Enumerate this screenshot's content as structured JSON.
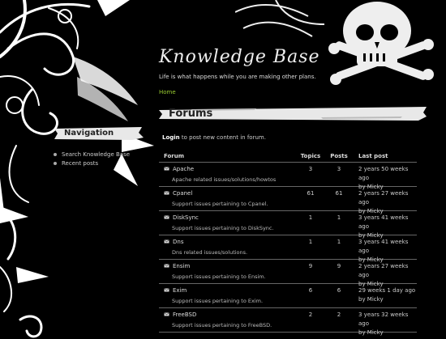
{
  "site": {
    "title": "Knowledge Base",
    "slogan": "Life is what happens while you are making other plans.",
    "breadcrumb": "Home"
  },
  "sidebar": {
    "heading": "Navigation",
    "items": [
      {
        "label": "Search Knowledge Base"
      },
      {
        "label": "Recent posts"
      }
    ]
  },
  "main": {
    "heading": "Forums",
    "login_link": "Login",
    "login_text": " to post new content in forum."
  },
  "table": {
    "headers": {
      "forum": "Forum",
      "topics": "Topics",
      "posts": "Posts",
      "last_post": "Last post"
    },
    "rows": [
      {
        "name": "Apache",
        "desc": "Apache related issues/solutions/howtos",
        "topics": "3",
        "posts": "3",
        "last_time": "2 years 50 weeks ago",
        "last_by": "by Micky"
      },
      {
        "name": "Cpanel",
        "desc": "Support issues pertaining to Cpanel.",
        "topics": "61",
        "posts": "61",
        "last_time": "2 years 27 weeks ago",
        "last_by": "by Micky"
      },
      {
        "name": "DiskSync",
        "desc": "Support issues pertaining to DiskSync.",
        "topics": "1",
        "posts": "1",
        "last_time": "3 years 41 weeks ago",
        "last_by": "by Micky"
      },
      {
        "name": "Dns",
        "desc": "Dns related issues/solutions.",
        "topics": "1",
        "posts": "1",
        "last_time": "3 years 41 weeks ago",
        "last_by": "by Micky"
      },
      {
        "name": "Ensim",
        "desc": "Support issues pertaining to Ensim.",
        "topics": "9",
        "posts": "9",
        "last_time": "2 years 27 weeks ago",
        "last_by": "by Micky"
      },
      {
        "name": "Exim",
        "desc": "Support issues pertaining to Exim.",
        "topics": "6",
        "posts": "6",
        "last_time": "29 weeks 1 day ago",
        "last_by": "by Micky"
      },
      {
        "name": "FreeBSD",
        "desc": "Support issues pertaining to FreeBSD.",
        "topics": "2",
        "posts": "2",
        "last_time": "3 years 32 weeks ago",
        "last_by": "by Micky"
      }
    ]
  }
}
